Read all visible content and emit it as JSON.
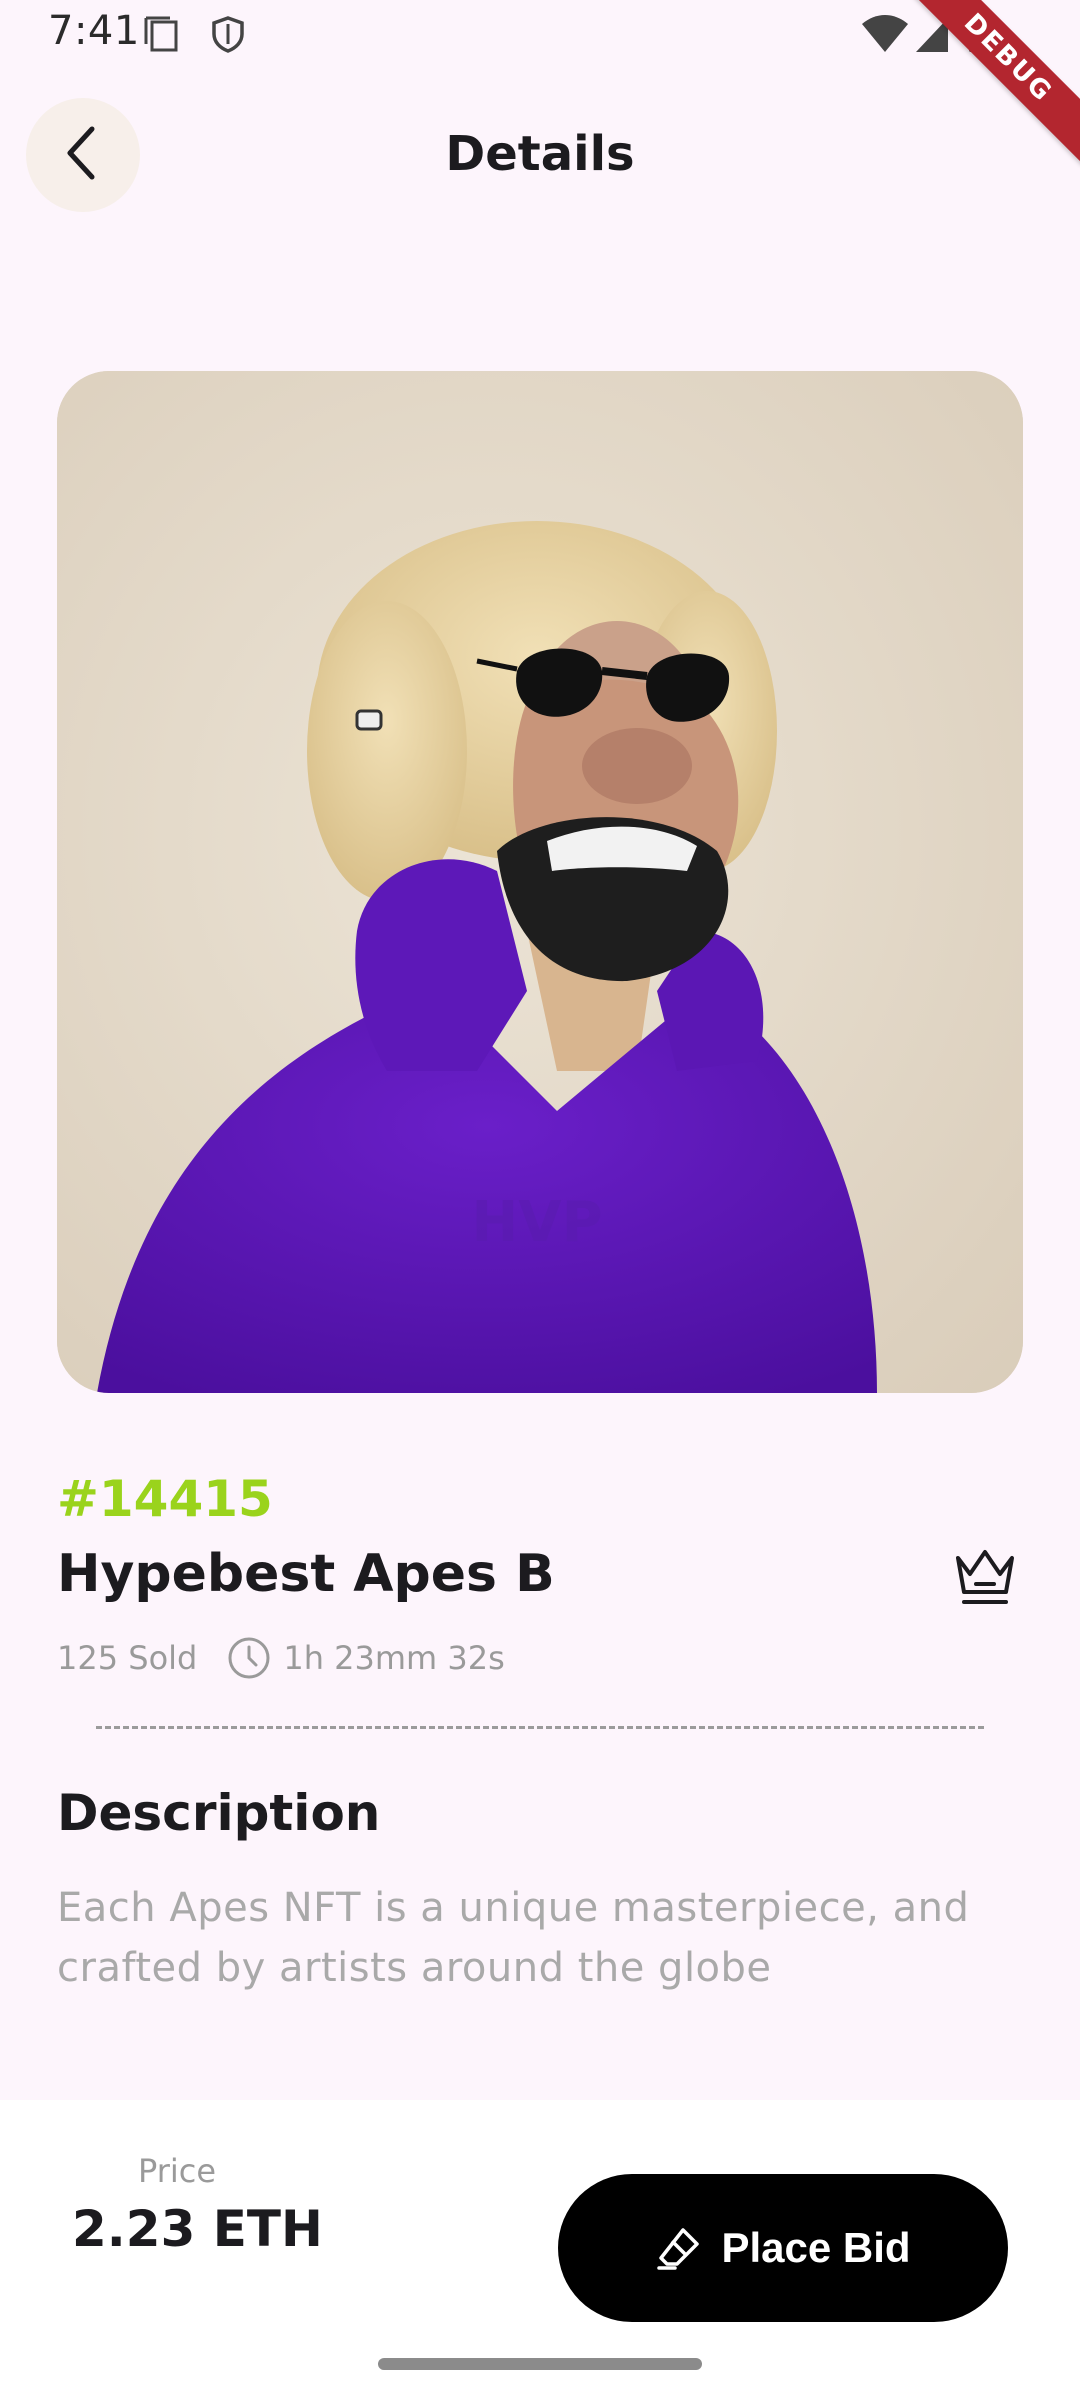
{
  "status_bar": {
    "time": "7:41",
    "icons": [
      "sim-card-icon",
      "shield-icon",
      "wifi-icon",
      "cellular-signal-icon",
      "battery-icon"
    ],
    "debug_label": "DEBUG"
  },
  "app_bar": {
    "title": "Details",
    "back_icon": "chevron-left-icon"
  },
  "nft": {
    "token_id": "#14415",
    "name": "Hypebest Apes B",
    "sold": "125 Sold",
    "time_left": "1h 23mm 32s",
    "crown_icon": "crown-icon",
    "hoodie_text": "HVP"
  },
  "description": {
    "heading": "Description",
    "text": "Each Apes NFT is a unique masterpiece, and crafted by artists around the globe"
  },
  "footer": {
    "price_label": "Price",
    "price_value": "2.23 ETH",
    "bid_label": "Place Bid",
    "bid_icon": "eraser-icon"
  },
  "colors": {
    "background": "#fdf5fc",
    "accent_green": "#9ad31c",
    "button": "#000000",
    "debug_banner": "#b3262f"
  }
}
